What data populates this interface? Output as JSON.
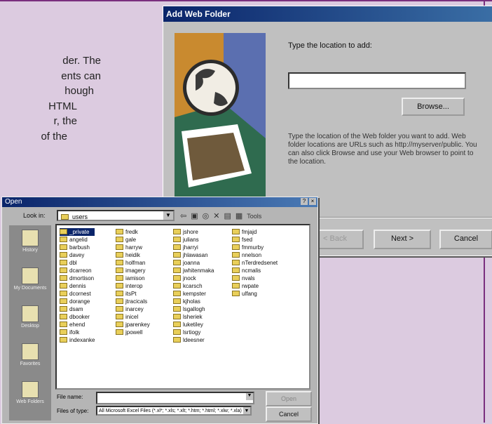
{
  "article": {
    "lines": [
      "der. The",
      "ents can",
      "hough",
      "HTML",
      "r, the",
      "of the"
    ]
  },
  "add_web_folder": {
    "title": "Add Web Folder",
    "prompt": "Type the location to add:",
    "location_value": "",
    "browse_label": "Browse...",
    "help_text": "Type the location of the Web folder you want to add. Web folder locations are URLs such as http://myserver/public. You can also click Browse and use your Web browser to point to the location.",
    "back_label": "< Back",
    "next_label": "Next >",
    "cancel_label": "Cancel"
  },
  "open_dialog": {
    "title": "Open",
    "look_in_label": "Look in:",
    "look_in_value": "users",
    "tools_label": "Tools",
    "places": [
      "History",
      "My Documents",
      "Desktop",
      "Favorites",
      "Web Folders"
    ],
    "columns": [
      [
        "_private",
        "angelid",
        "barbush",
        "davey",
        "dbl",
        "dcarreon",
        "dmortison",
        "dennis",
        "dcornest",
        "dorange",
        "dsam",
        "dbooker",
        "ehend",
        "ifolk",
        "indexanke"
      ],
      [
        "fredk",
        "gale",
        "harryw",
        "heidik",
        "holfman",
        "imagery",
        "iamison",
        "interop",
        "itsPt",
        "jtracicals",
        "inarcey",
        "inicel",
        "jparenkey",
        "jpowell"
      ],
      [
        "jshore",
        "julians",
        "jharryi",
        "jhlawasan",
        "joanna",
        "jwhitenmaka",
        "jnock",
        "kcarsch",
        "kempster",
        "kjholas",
        "lsgallogh",
        "lsheriek",
        "luketiley",
        "lsrtiogy",
        "ldeesner"
      ],
      [
        "fmjajd",
        "fsed",
        "fmmurby",
        "nnelson",
        "nTerdredsenet",
        "ncmalis",
        "nvals",
        "rwpate",
        "ulfang"
      ]
    ],
    "file_name_label": "File name:",
    "file_name_value": "",
    "files_of_type_label": "Files of type:",
    "files_of_type_value": "All Microsoft Excel Files (*.xl*; *.xls; *.xlt; *.htm; *.html; *.xlw; *.xla)",
    "open_label": "Open",
    "cancel_label": "Cancel"
  }
}
